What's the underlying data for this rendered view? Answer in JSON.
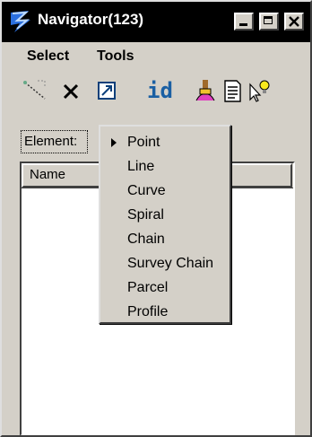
{
  "window": {
    "title": "Navigator(123)"
  },
  "menubar": {
    "items": [
      {
        "label": "Select"
      },
      {
        "label": "Tools"
      }
    ]
  },
  "toolbar": {
    "id_label": "id"
  },
  "element_button": {
    "label": "Element:"
  },
  "list": {
    "columns": [
      "Name"
    ]
  },
  "popup_menu": {
    "selected": "Point",
    "items": [
      {
        "label": "Point"
      },
      {
        "label": "Line"
      },
      {
        "label": "Curve"
      },
      {
        "label": "Spiral"
      },
      {
        "label": "Chain"
      },
      {
        "label": "Survey Chain"
      },
      {
        "label": "Parcel"
      },
      {
        "label": "Profile"
      }
    ]
  },
  "icons": {
    "app": "navigator-app-icon",
    "tools": [
      "select-line-icon",
      "delete-x-icon",
      "zoom-to-icon",
      "id-icon",
      "highlight-brush-icon",
      "report-icon",
      "query-pointer-icon"
    ]
  }
}
